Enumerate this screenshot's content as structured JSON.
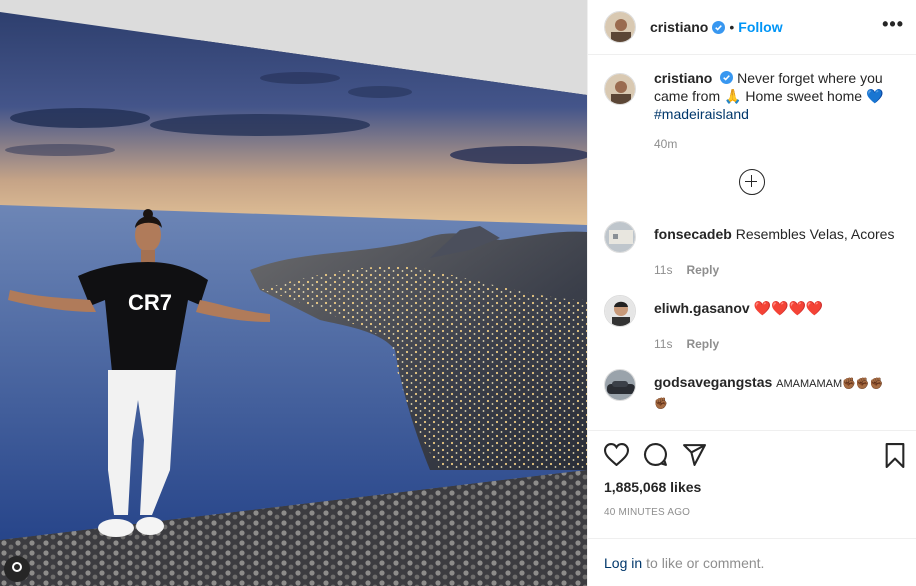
{
  "post": {
    "username": "cristiano",
    "follow_label": "Follow",
    "separator": "•",
    "more_label": "•••",
    "caption": {
      "username": "cristiano",
      "text": "Never forget where you came from 🙏 Home sweet home 💙",
      "hashtag": "#madeiraisland",
      "age": "40m"
    },
    "comments": [
      {
        "username": "fonsecadeb",
        "text": "Resembles Velas, Acores",
        "age": "11s",
        "reply": "Reply"
      },
      {
        "username": "eliwh.gasanov",
        "text": "❤️❤️❤️❤️",
        "age": "11s",
        "reply": "Reply"
      },
      {
        "username": "godsavegangstas",
        "text": "AMAMAMAM✊🏾✊🏾✊🏾✊🏾"
      }
    ],
    "likes": "1,885,068 likes",
    "timestamp": "40 MINUTES AGO",
    "login": {
      "link": "Log in",
      "rest": "to like or comment."
    }
  },
  "icons": {
    "verified": "verified-badge-icon",
    "like": "heart-icon",
    "comment": "comment-icon",
    "share": "paper-plane-icon",
    "save": "bookmark-icon",
    "load_more": "plus-circle-icon"
  },
  "colors": {
    "accent": "#0095f6",
    "verified": "#3897f0",
    "link": "#00376b",
    "muted": "#8e8e8e"
  }
}
